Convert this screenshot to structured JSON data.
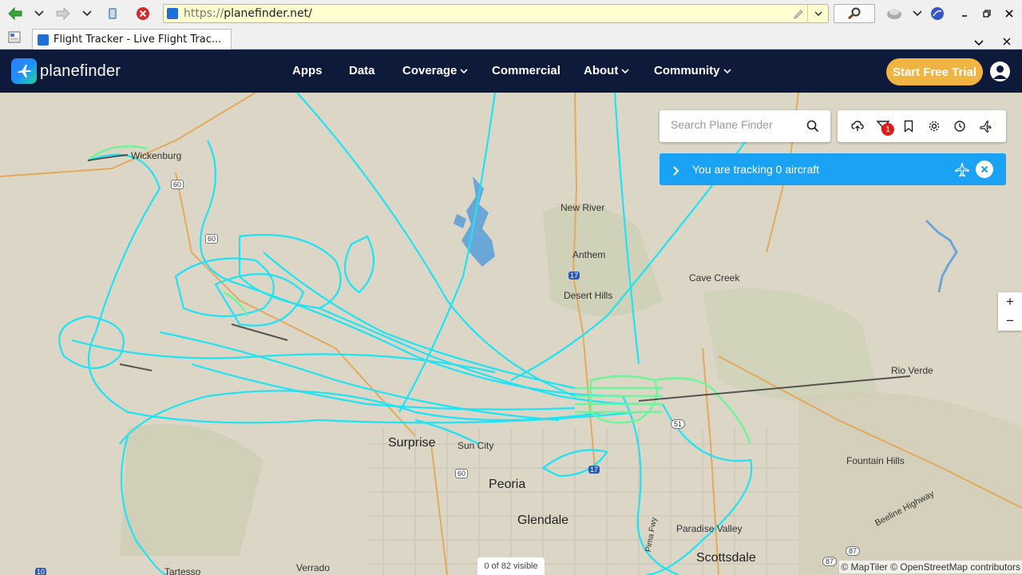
{
  "browser": {
    "url_scheme": "https://",
    "url_host": "planefinder.net/",
    "tab_title": "Flight Tracker - Live Flight Trac..."
  },
  "navbar": {
    "logo_text": "planefinder",
    "items": [
      {
        "label": "Apps",
        "dropdown": false
      },
      {
        "label": "Data",
        "dropdown": false
      },
      {
        "label": "Coverage",
        "dropdown": true
      },
      {
        "label": "Commercial",
        "dropdown": false
      },
      {
        "label": "About",
        "dropdown": true
      },
      {
        "label": "Community",
        "dropdown": true
      }
    ],
    "trial_button": "Start Free Trial"
  },
  "search": {
    "placeholder": "Search Plane Finder"
  },
  "toolbar": {
    "filter_badge": "1",
    "icons": [
      "cloud-upload-icon",
      "filter-icon",
      "bookmark-icon",
      "gear-icon",
      "history-icon",
      "plane-arrival-icon"
    ]
  },
  "tracking": {
    "text": "You are tracking 0 aircraft"
  },
  "zoom": {
    "in": "+",
    "out": "−"
  },
  "map": {
    "places": {
      "wickenburg": "Wickenburg",
      "new_river": "New River",
      "anthem": "Anthem",
      "cave_creek": "Cave Creek",
      "desert_hills": "Desert Hills",
      "rio_verde": "Rio Verde",
      "surprise": "Surprise",
      "sun_city": "Sun City",
      "peoria": "Peoria",
      "glendale": "Glendale",
      "fountain_hills": "Fountain Hills",
      "paradise_valley": "Paradise Valley",
      "scottsdale": "Scottsdale",
      "tartesso": "Tartesso",
      "verrado": "Verrado",
      "beeline_highway": "Beeline Highway",
      "pima_fwy": "Pima Fwy"
    },
    "shields": {
      "us60_a": "60",
      "us60_b": "60",
      "us60_c": "60",
      "i17_a": "17",
      "i17_b": "17",
      "sr51": "51",
      "sr87_a": "87",
      "sr87_b": "87",
      "i10": "10"
    },
    "visible_count": "0 of 82 visible",
    "attribution": "© MapTiler © OpenStreetMap contributors"
  }
}
